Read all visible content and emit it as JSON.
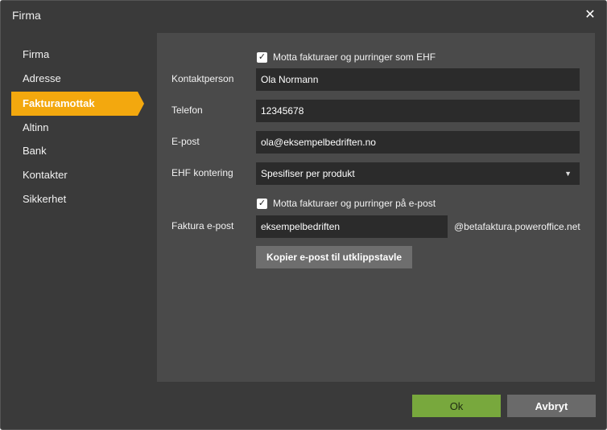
{
  "dialog": {
    "title": "Firma",
    "close_icon": "close-icon"
  },
  "sidebar": {
    "items": [
      {
        "label": "Firma",
        "active": false
      },
      {
        "label": "Adresse",
        "active": false
      },
      {
        "label": "Fakturamottak",
        "active": true
      },
      {
        "label": "Altinn",
        "active": false
      },
      {
        "label": "Bank",
        "active": false
      },
      {
        "label": "Kontakter",
        "active": false
      },
      {
        "label": "Sikkerhet",
        "active": false
      }
    ]
  },
  "form": {
    "ehf_checkbox": {
      "label": "Motta fakturaer og purringer som EHF",
      "checked": true
    },
    "contact_person": {
      "label": "Kontaktperson",
      "value": "Ola Normann"
    },
    "phone": {
      "label": "Telefon",
      "value": "12345678"
    },
    "email": {
      "label": "E-post",
      "value": "ola@eksempelbedriften.no"
    },
    "ehf_kontering": {
      "label": "EHF kontering",
      "value": "Spesifiser per produkt"
    },
    "email_checkbox": {
      "label": "Motta fakturaer og purringer på e-post",
      "checked": true
    },
    "invoice_email": {
      "label": "Faktura e-post",
      "value": "eksempelbedriften",
      "suffix": "@betafaktura.poweroffice.net"
    },
    "copy_button": "Kopier e-post til utklippstavle"
  },
  "footer": {
    "ok_label": "Ok",
    "cancel_label": "Avbryt"
  },
  "colors": {
    "accent": "#f3a80e",
    "ok_button": "#78a83d",
    "panel": "#4a4a4a",
    "background": "#3a3a3a"
  }
}
